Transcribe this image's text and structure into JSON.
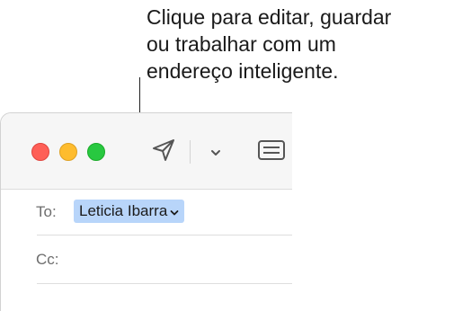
{
  "callout": {
    "text": "Clique para editar, guardar\nou trabalhar com um\nendereço inteligente."
  },
  "toolbar": {
    "icons": [
      "close-button",
      "minimize-button",
      "zoom-button",
      "send-icon",
      "chevron-down-icon",
      "header-fields-icon"
    ]
  },
  "fields": {
    "to_label": "To:",
    "to_address": "Leticia Ibarra",
    "cc_label": "Cc:"
  },
  "colors": {
    "token_bg": "#b8d5fa",
    "close": "#fe5f57",
    "minimize": "#febc2e",
    "zoom": "#28c840"
  }
}
